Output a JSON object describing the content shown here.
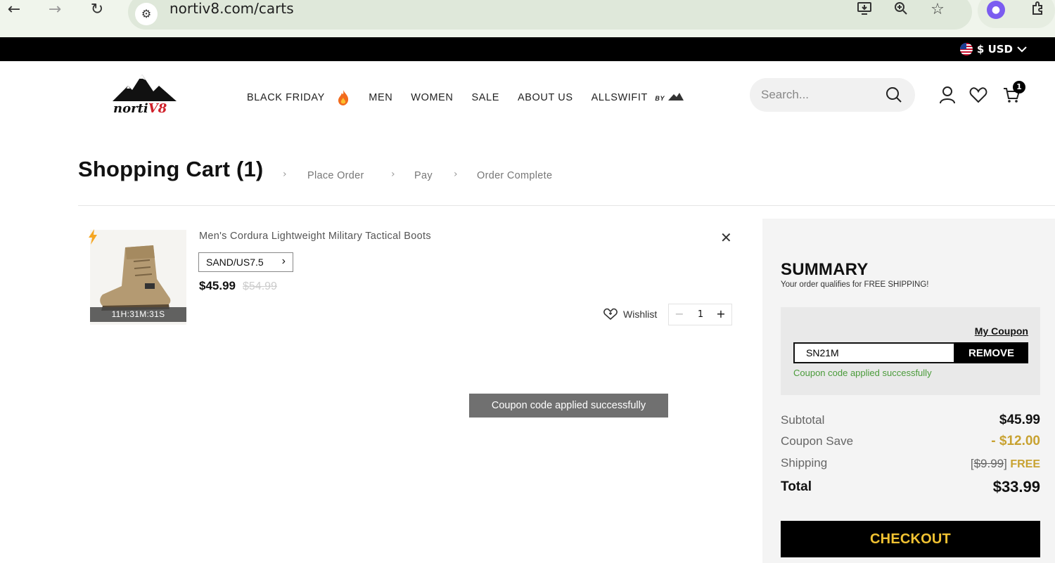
{
  "browser": {
    "url": "nortiv8.com/carts"
  },
  "topbar": {
    "currency": "$ USD"
  },
  "header": {
    "logo_text_a": "norti",
    "logo_text_b": "V8",
    "nav": [
      {
        "label": "BLACK FRIDAY"
      },
      {
        "label": "MEN"
      },
      {
        "label": "WOMEN"
      },
      {
        "label": "SALE"
      },
      {
        "label": "ABOUT US"
      },
      {
        "label": "ALLSWIFIT"
      }
    ],
    "allswifit_badge": "BY",
    "search_placeholder": "Search...",
    "cart_count": "1"
  },
  "page": {
    "title": "Shopping Cart (1)",
    "steps": [
      "Place Order",
      "Pay",
      "Order Complete"
    ]
  },
  "cart_item": {
    "name": "Men's Cordura Lightweight Military Tactical Boots",
    "variant": "SAND/US7.5",
    "price": "$45.99",
    "old_price": "$54.99",
    "timer": "11H:31M:31S",
    "wishlist_label": "Wishlist",
    "quantity": "1"
  },
  "toast": {
    "message": "Coupon code applied successfully"
  },
  "summary": {
    "title": "SUMMARY",
    "subtitle": "Your order qualifies for FREE SHIPPING!",
    "my_coupon": "My Coupon",
    "coupon_code": "SN21M",
    "remove_label": "REMOVE",
    "coupon_message": "Coupon code applied successfully",
    "subtotal_label": "Subtotal",
    "subtotal_value": "$45.99",
    "coupon_label": "Coupon Save",
    "coupon_value": "- $12.00",
    "shipping_label": "Shipping",
    "shipping_open": "[",
    "shipping_old": "$9.99",
    "shipping_close": "]",
    "shipping_free": "FREE",
    "total_label": "Total",
    "total_value": "$33.99",
    "checkout_label": "CHECKOUT"
  },
  "colors": {
    "accent_gold": "#c8a231",
    "checkout_text": "#f1c232",
    "success_green": "#4a9b3a"
  }
}
